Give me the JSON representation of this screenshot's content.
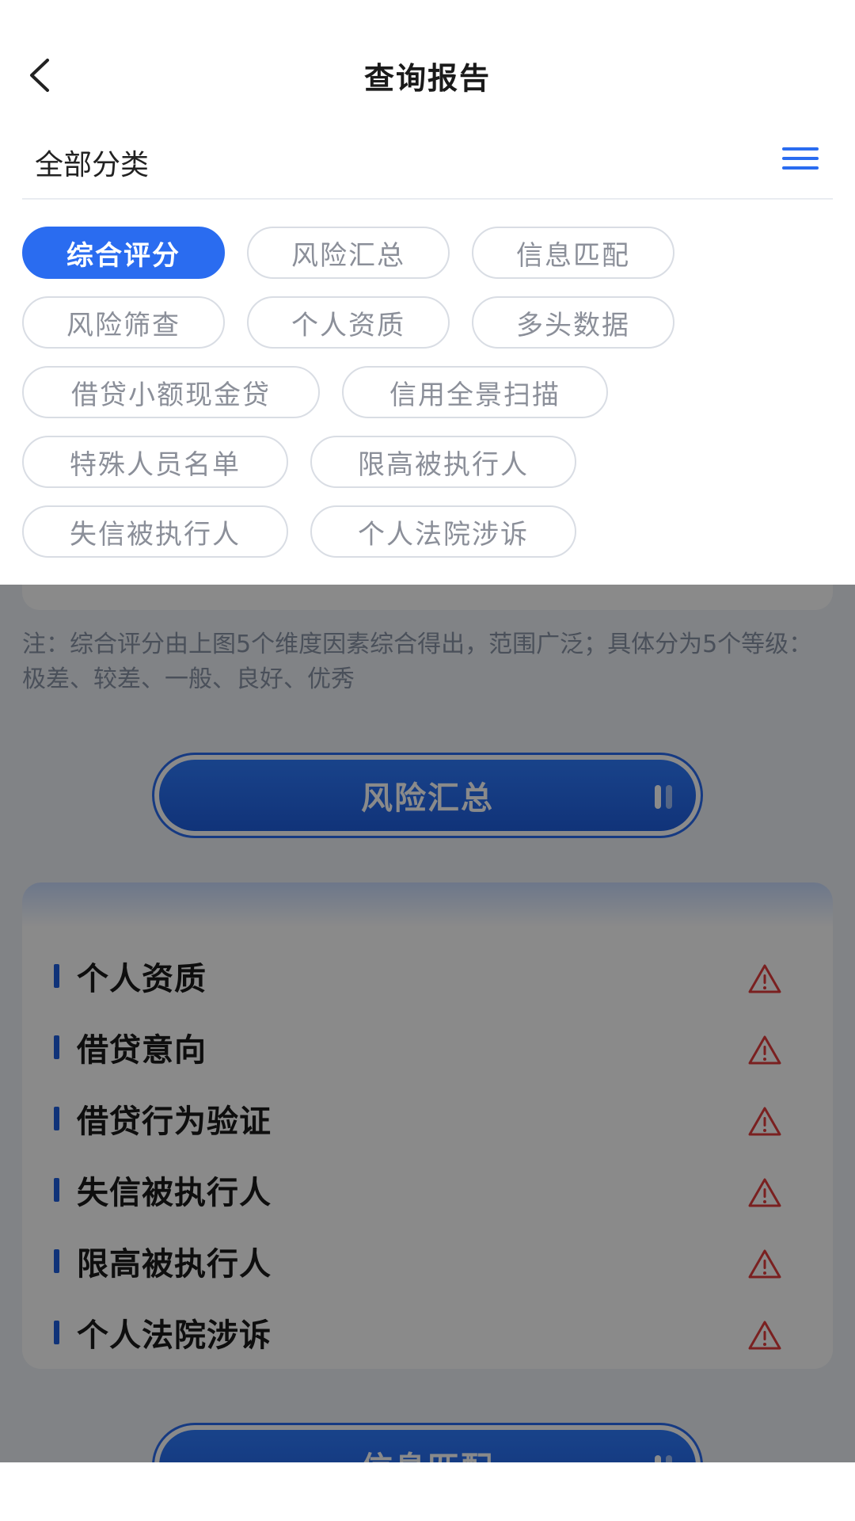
{
  "header": {
    "title": "查询报告"
  },
  "category": {
    "title": "全部分类"
  },
  "tags": [
    {
      "label": "综合评分",
      "active": true
    },
    {
      "label": "风险汇总",
      "active": false
    },
    {
      "label": "信息匹配",
      "active": false
    },
    {
      "label": "风险筛查",
      "active": false
    },
    {
      "label": "个人资质",
      "active": false
    },
    {
      "label": "多头数据",
      "active": false
    },
    {
      "label": "借贷小额现金贷",
      "active": false
    },
    {
      "label": "信用全景扫描",
      "active": false
    },
    {
      "label": "特殊人员名单",
      "active": false
    },
    {
      "label": "限高被执行人",
      "active": false
    },
    {
      "label": "失信被执行人",
      "active": false
    },
    {
      "label": "个人法院涉诉",
      "active": false
    }
  ],
  "note": {
    "text": "注：综合评分由上图5个维度因素综合得出，范围广泛；具体分为5个等级：极差、较差、一般、良好、优秀"
  },
  "risk_summary": {
    "button_label": "风险汇总",
    "items": [
      {
        "label": "个人资质"
      },
      {
        "label": "借贷意向"
      },
      {
        "label": "借贷行为验证"
      },
      {
        "label": "失信被执行人"
      },
      {
        "label": "限高被执行人"
      },
      {
        "label": "个人法院涉诉"
      }
    ]
  },
  "info_match": {
    "button_label": "信息匹配"
  },
  "colors": {
    "accent": "#2a6cf0",
    "warning": "#e23b3b"
  }
}
